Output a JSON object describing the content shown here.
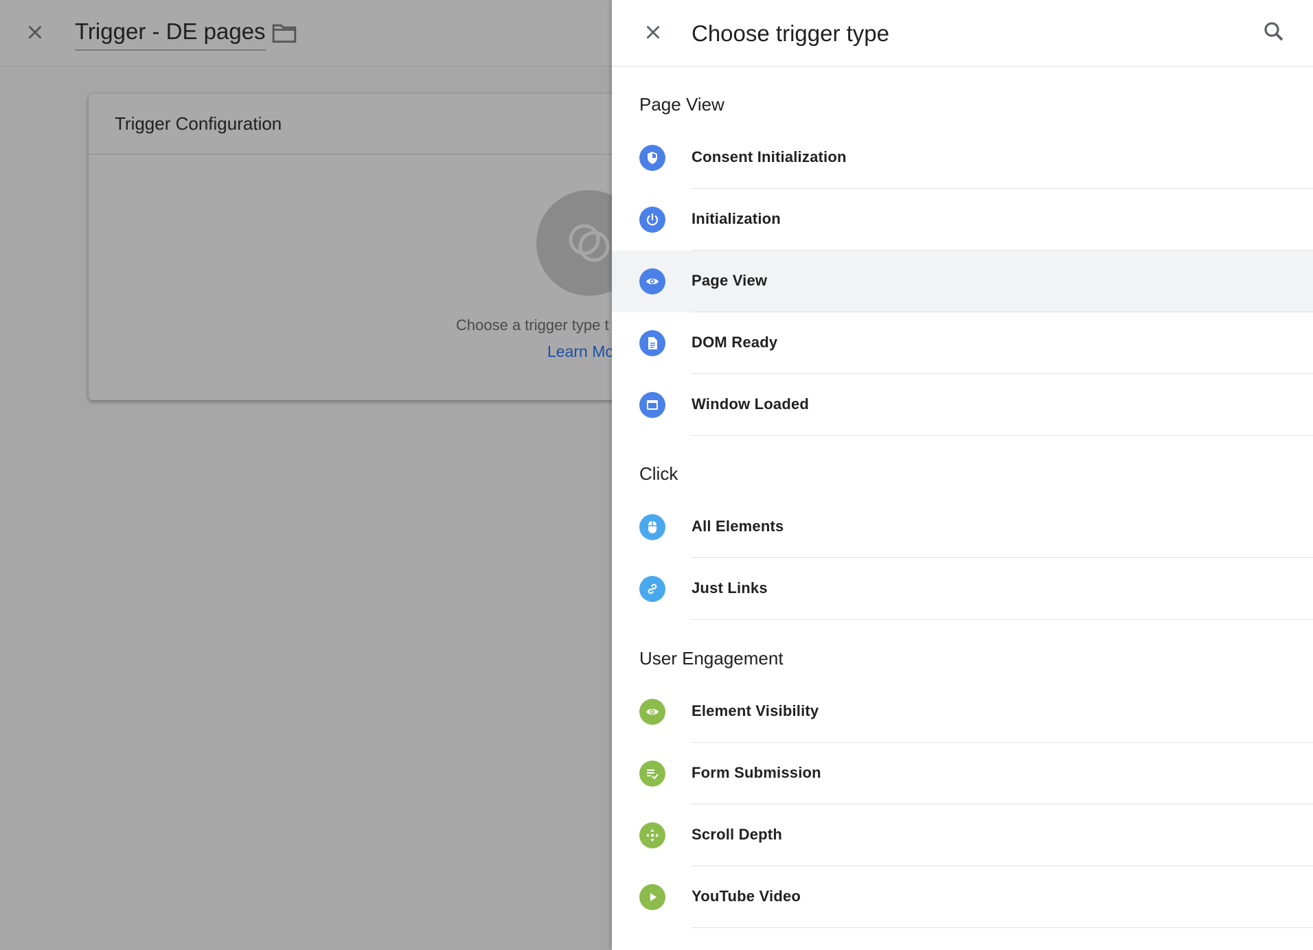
{
  "editor": {
    "title": "Trigger - DE pages",
    "card_title": "Trigger Configuration",
    "card_hint": "Choose a trigger type t",
    "card_link": "Learn Mo"
  },
  "panel": {
    "title": "Choose trigger type",
    "sections": [
      {
        "title": "Page View",
        "color": "#4a80e8",
        "items": [
          {
            "label": "Consent Initialization",
            "icon": "shield-icon"
          },
          {
            "label": "Initialization",
            "icon": "power-icon"
          },
          {
            "label": "Page View",
            "icon": "eye-icon",
            "selected": true
          },
          {
            "label": "DOM Ready",
            "icon": "document-icon"
          },
          {
            "label": "Window Loaded",
            "icon": "window-icon"
          }
        ]
      },
      {
        "title": "Click",
        "color": "#4aa8ee",
        "items": [
          {
            "label": "All Elements",
            "icon": "mouse-icon"
          },
          {
            "label": "Just Links",
            "icon": "link-icon"
          }
        ]
      },
      {
        "title": "User Engagement",
        "color": "#8cbc4c",
        "items": [
          {
            "label": "Element Visibility",
            "icon": "eye-icon"
          },
          {
            "label": "Form Submission",
            "icon": "form-check-icon"
          },
          {
            "label": "Scroll Depth",
            "icon": "scroll-arrows-icon"
          },
          {
            "label": "YouTube Video",
            "icon": "play-icon"
          }
        ]
      }
    ]
  }
}
